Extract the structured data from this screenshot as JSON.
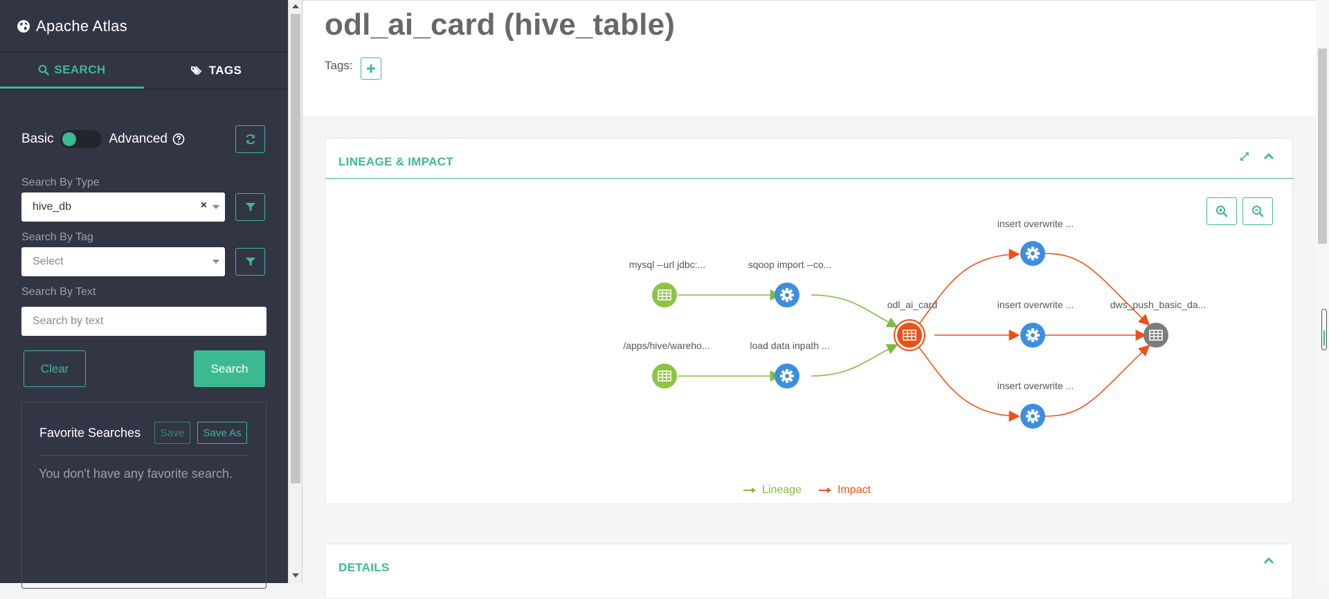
{
  "app": {
    "title": "Apache Atlas"
  },
  "sidebar": {
    "tabs": [
      {
        "label": "SEARCH"
      },
      {
        "label": "TAGS"
      }
    ],
    "mode": {
      "basic_label": "Basic",
      "advanced_label": "Advanced"
    },
    "type_filter": {
      "label": "Search By Type",
      "value": "hive_db"
    },
    "tag_filter": {
      "label": "Search By Tag",
      "placeholder": "Select"
    },
    "text_filter": {
      "label": "Search By Text",
      "placeholder": "Search by text"
    },
    "clear_label": "Clear",
    "search_label": "Search",
    "favorites": {
      "title": "Favorite Searches",
      "save_label": "Save",
      "save_as_label": "Save As",
      "empty_text": "You don't have any favorite search."
    }
  },
  "entity": {
    "title": "odl_ai_card (hive_table)",
    "tags_label": "Tags:"
  },
  "lineage": {
    "title": "LINEAGE & IMPACT",
    "nodes": {
      "src1": "mysql --url jdbc:...",
      "proc1": "sqoop import --co...",
      "src2": "/apps/hive/wareho...",
      "proc2": "load data inpath ...",
      "center": "odl_ai_card",
      "ins1": "insert overwrite ...",
      "ins2": "insert overwrite ...",
      "ins3": "insert overwrite ...",
      "target": "dws_push_basic_da..."
    },
    "legend": {
      "lineage": "Lineage",
      "impact": "Impact"
    },
    "colors": {
      "lineage": "#80bb3d",
      "impact": "#f04f14",
      "process": "#3d8ee1",
      "dataset": "#8dc443",
      "current": "#f04f14",
      "other": "#7c7c7c"
    }
  },
  "details": {
    "title": "DETAILS"
  }
}
